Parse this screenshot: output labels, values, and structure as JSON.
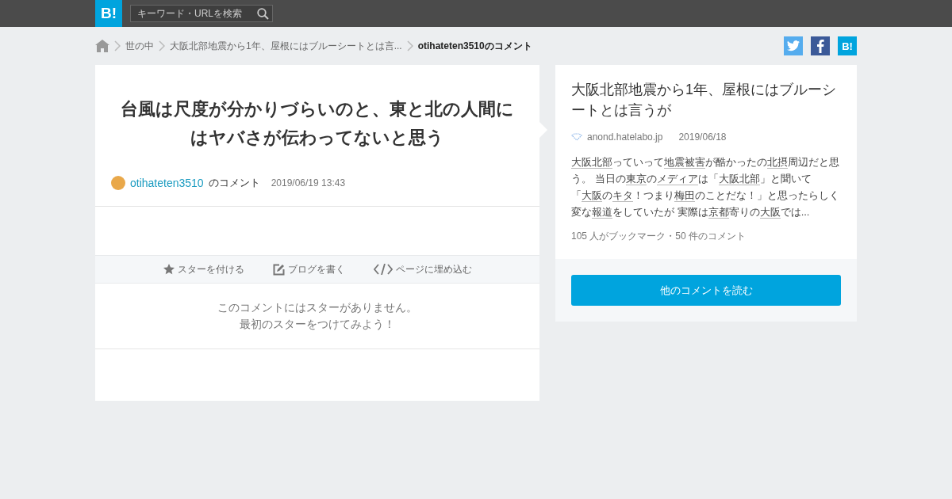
{
  "header": {
    "logo": "B!",
    "search": {
      "placeholder": "キーワード・URLを検索"
    }
  },
  "breadcrumbs": [
    {
      "label": "世の中",
      "current": false
    },
    {
      "label": "大阪北部地震から1年、屋根にはブルーシートとは言...",
      "current": false
    },
    {
      "label": "otihateten3510のコメント",
      "current": true
    }
  ],
  "share": [
    {
      "kind": "twitter"
    },
    {
      "kind": "facebook"
    },
    {
      "kind": "hatena",
      "label": "B!"
    }
  ],
  "comment": {
    "text": "台風は尺度が分かりづらいのと、東と北の人間にはヤバさが伝わってないと思う",
    "user": "otihateten3510",
    "suffix": "のコメント",
    "time": "2019/06/19 13:43",
    "actions": [
      {
        "kind": "star",
        "label": "スターを付ける"
      },
      {
        "kind": "blog",
        "label": "ブログを書く"
      },
      {
        "kind": "embed",
        "label": "ページに埋め込む"
      }
    ],
    "stars_message": [
      "このコメントにはスターがありません。",
      "最初のスターをつけてみよう！"
    ]
  },
  "entry": {
    "title": "大阪北部地震から1年、屋根にはブルーシートとは言うが",
    "domain": "anond.hatelabo.jp",
    "date": "2019/06/18",
    "excerpt": [
      {
        "text": "大阪北部",
        "link": true
      },
      {
        "text": "っていって",
        "link": false
      },
      {
        "text": "地震被害",
        "link": true
      },
      {
        "text": "が酷かったの",
        "link": false
      },
      {
        "text": "北摂",
        "link": true
      },
      {
        "text": "周辺だと思う。 当日の",
        "link": false
      },
      {
        "text": "東京",
        "link": true
      },
      {
        "text": "の",
        "link": false
      },
      {
        "text": "メディア",
        "link": true
      },
      {
        "text": "は「",
        "link": false
      },
      {
        "text": "大阪北部",
        "link": true
      },
      {
        "text": "」と聞いて「",
        "link": false
      },
      {
        "text": "大阪",
        "link": true
      },
      {
        "text": "の",
        "link": false
      },
      {
        "text": "キタ",
        "link": true
      },
      {
        "text": "！つまり",
        "link": false
      },
      {
        "text": "梅田",
        "link": true
      },
      {
        "text": "のことだな！」と思ったらしく変な",
        "link": false
      },
      {
        "text": "報道",
        "link": true
      },
      {
        "text": "をしていたが 実際は",
        "link": false
      },
      {
        "text": "京都",
        "link": true
      },
      {
        "text": "寄りの",
        "link": false
      },
      {
        "text": "大阪",
        "link": true
      },
      {
        "text": "では...",
        "link": false
      }
    ],
    "stats": "105 人がブックマーク・50 件のコメント",
    "button": "他のコメントを読む"
  }
}
